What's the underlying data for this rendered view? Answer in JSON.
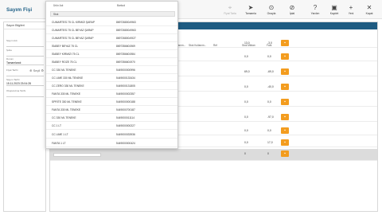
{
  "app": {
    "title": "Sayım Fişi"
  },
  "toolbar": {
    "buttons": [
      {
        "label": "Fiyat Tarla",
        "icon": "tag-icon",
        "disabled": true
      },
      {
        "label": "Tamamla",
        "icon": "send-icon",
        "disabled": false
      },
      {
        "label": "Onayla",
        "icon": "check-circle-icon",
        "disabled": false
      },
      {
        "label": "İptal",
        "icon": "cancel-icon",
        "disabled": false
      },
      {
        "label": "Yardım",
        "icon": "help-icon",
        "disabled": false
      },
      {
        "label": "Kaydet",
        "icon": "save-icon",
        "disabled": false
      },
      {
        "label": "Yeni",
        "icon": "plus-icon",
        "disabled": false
      },
      {
        "label": "Kapat",
        "icon": "close-icon",
        "disabled": false
      }
    ]
  },
  "left_panel": {
    "title": "Sayım Bilgileri",
    "fields": [
      {
        "label": "Sayım Adı",
        "value": ""
      },
      {
        "label": "Şube",
        "value": ""
      },
      {
        "label": "Durum",
        "value": "Tamamlandı"
      },
      {
        "label": "Fiyat Tarihi",
        "value": ""
      },
      {
        "label": "Sayım Tarihi",
        "value": "15.11.2023 23:04:28"
      },
      {
        "label": "Oluşturulma Tarihi",
        "value": ""
      }
    ],
    "price_icons": "⊕ Seçil ⚙"
  },
  "grid": {
    "columns": [
      "Stok Kullanım...",
      "Stok Kullanım...",
      "Ref",
      "Stok Miktarı",
      "Fark"
    ],
    "input_placeholder": "",
    "rows": [
      {
        "stock_qty": "13,0",
        "diff": "-3,0"
      },
      {
        "stock_qty": "0,0",
        "diff": "0,0"
      },
      {
        "stock_qty": "69,0",
        "diff": "-69,0"
      },
      {
        "stock_qty": "0,0",
        "diff": "-40,0"
      },
      {
        "stock_qty": "0,0",
        "diff": "0,0"
      },
      {
        "stock_qty": "0,0",
        "diff": "-97,0"
      },
      {
        "stock_qty": "0,0",
        "diff": "0,0"
      },
      {
        "stock_qty": "0,0",
        "diff": "17,0"
      },
      {
        "stock_qty": "0",
        "diff": "0"
      }
    ]
  },
  "dropdown": {
    "col_name": "Ürün Adı",
    "col_barcode": "Barkod",
    "search_value": "Stok",
    "items": [
      {
        "name": "CUMARTESİ 75 CL KIRMIZI ŞARAP",
        "barcode": "869726800/4963"
      },
      {
        "name": "CUMARTESİ 75 CL BEYAZ ŞARAP",
        "barcode": "869726800/4963"
      },
      {
        "name": "CUMARTESİ 75 CL BEYAZ ŞARAP",
        "barcode": "869726800/4927"
      },
      {
        "name": "İSABEY BEYAZ 75 CL",
        "barcode": "8697356601969"
      },
      {
        "name": "İSABEY KIRMIZI 75 CL",
        "barcode": "8697356601984"
      },
      {
        "name": "İSABEY ROZE 75 CL",
        "barcode": "8697356601970"
      },
      {
        "name": "CC 330 ML TENEKE",
        "barcode": "5449000000996"
      },
      {
        "name": "CC LIME 330 ML TENEKE",
        "barcode": "5449000133434"
      },
      {
        "name": "CC ZERO 330 ML TENEKE",
        "barcode": "5449000131805"
      },
      {
        "name": "FANTA 330 ML TENEKE",
        "barcode": "5449000002357"
      },
      {
        "name": "SPRİTE 330 ML TENEKE",
        "barcode": "5449000000188"
      },
      {
        "name": "FANTA 330 ML TENEKE",
        "barcode": "5449000700187"
      },
      {
        "name": "CC 330 ML TENEKE",
        "barcode": "5449000011114"
      },
      {
        "name": "CC 1 LT",
        "barcode": "5449000000227"
      },
      {
        "name": "CC LIME 1 LT",
        "barcode": "5449000033936"
      },
      {
        "name": "FANTA 1 LT",
        "barcode": "5449000000424"
      }
    ]
  },
  "colors": {
    "accent": "#1f5c82",
    "delete": "#f39c1e",
    "title": "#1e5f86"
  }
}
